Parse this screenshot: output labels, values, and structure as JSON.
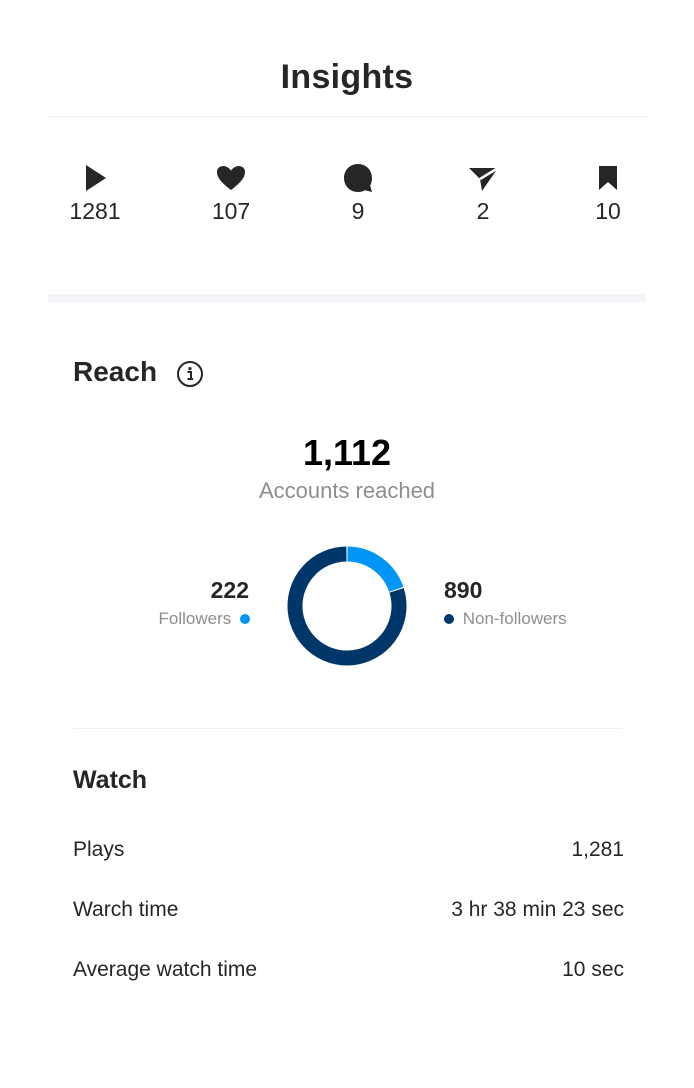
{
  "header": {
    "title": "Insights"
  },
  "stats": [
    {
      "icon": "play-icon",
      "value": "1281"
    },
    {
      "icon": "heart-icon",
      "value": "107"
    },
    {
      "icon": "comment-icon",
      "value": "9"
    },
    {
      "icon": "share-icon",
      "value": "2"
    },
    {
      "icon": "bookmark-icon",
      "value": "10"
    }
  ],
  "reach": {
    "heading": "Reach",
    "info_icon": "info-icon",
    "total": "1,112",
    "subtitle": "Accounts reached",
    "followers": {
      "value": "222",
      "label": "Followers",
      "color": "#0095f6"
    },
    "non_followers": {
      "value": "890",
      "label": "Non-followers",
      "color": "#00376b"
    }
  },
  "chart_data": {
    "type": "pie",
    "categories": [
      "Followers",
      "Non-followers"
    ],
    "values": [
      222,
      890
    ],
    "colors": [
      "#0095f6",
      "#00376b"
    ],
    "donut": true
  },
  "watch": {
    "heading": "Watch",
    "rows": [
      {
        "label": "Plays",
        "value": "1,281"
      },
      {
        "label": "Warch time",
        "value": "3 hr 38 min 23 sec"
      },
      {
        "label": "Average watch time",
        "value": "10 sec"
      }
    ]
  }
}
